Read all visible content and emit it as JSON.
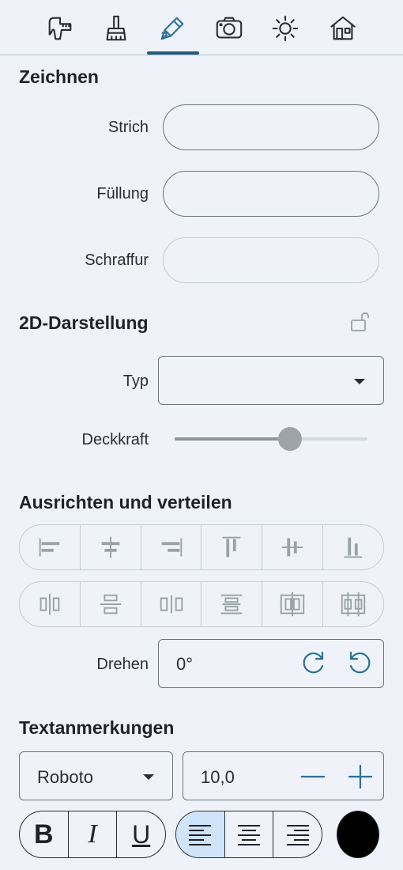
{
  "tabs": [
    {
      "name": "tab-measure",
      "icon": "caliper-icon"
    },
    {
      "name": "tab-paint",
      "icon": "brush-icon"
    },
    {
      "name": "tab-draw",
      "icon": "pencil-icon",
      "active": true
    },
    {
      "name": "tab-camera",
      "icon": "camera-icon"
    },
    {
      "name": "tab-light",
      "icon": "sun-icon"
    },
    {
      "name": "tab-building",
      "icon": "house-icon"
    }
  ],
  "draw": {
    "title": "Zeichnen",
    "stroke_label": "Strich",
    "fill_label": "Füllung",
    "hatch_label": "Schraffur"
  },
  "display2d": {
    "title": "2D-Darstellung",
    "lock_icon": "unlock-icon",
    "type_label": "Typ",
    "type_value": "",
    "opacity_label": "Deckkraft",
    "opacity_fraction": 0.6
  },
  "align": {
    "title": "Ausrichten und verteilen",
    "rotate_label": "Drehen",
    "rotate_value": "0°",
    "rotate_cw_icon": "rotate-cw-icon",
    "rotate_ccw_icon": "rotate-ccw-icon"
  },
  "text": {
    "title": "Textanmerkungen",
    "font_value": "Roboto",
    "size_value": "10,0",
    "bold_label": "B",
    "italic_label": "I",
    "underline_label": "U",
    "color": "#000000"
  },
  "colors": {
    "accent": "#245a80",
    "active_bg": "#cfe3f9",
    "icon_blue": "#2f6f96"
  }
}
